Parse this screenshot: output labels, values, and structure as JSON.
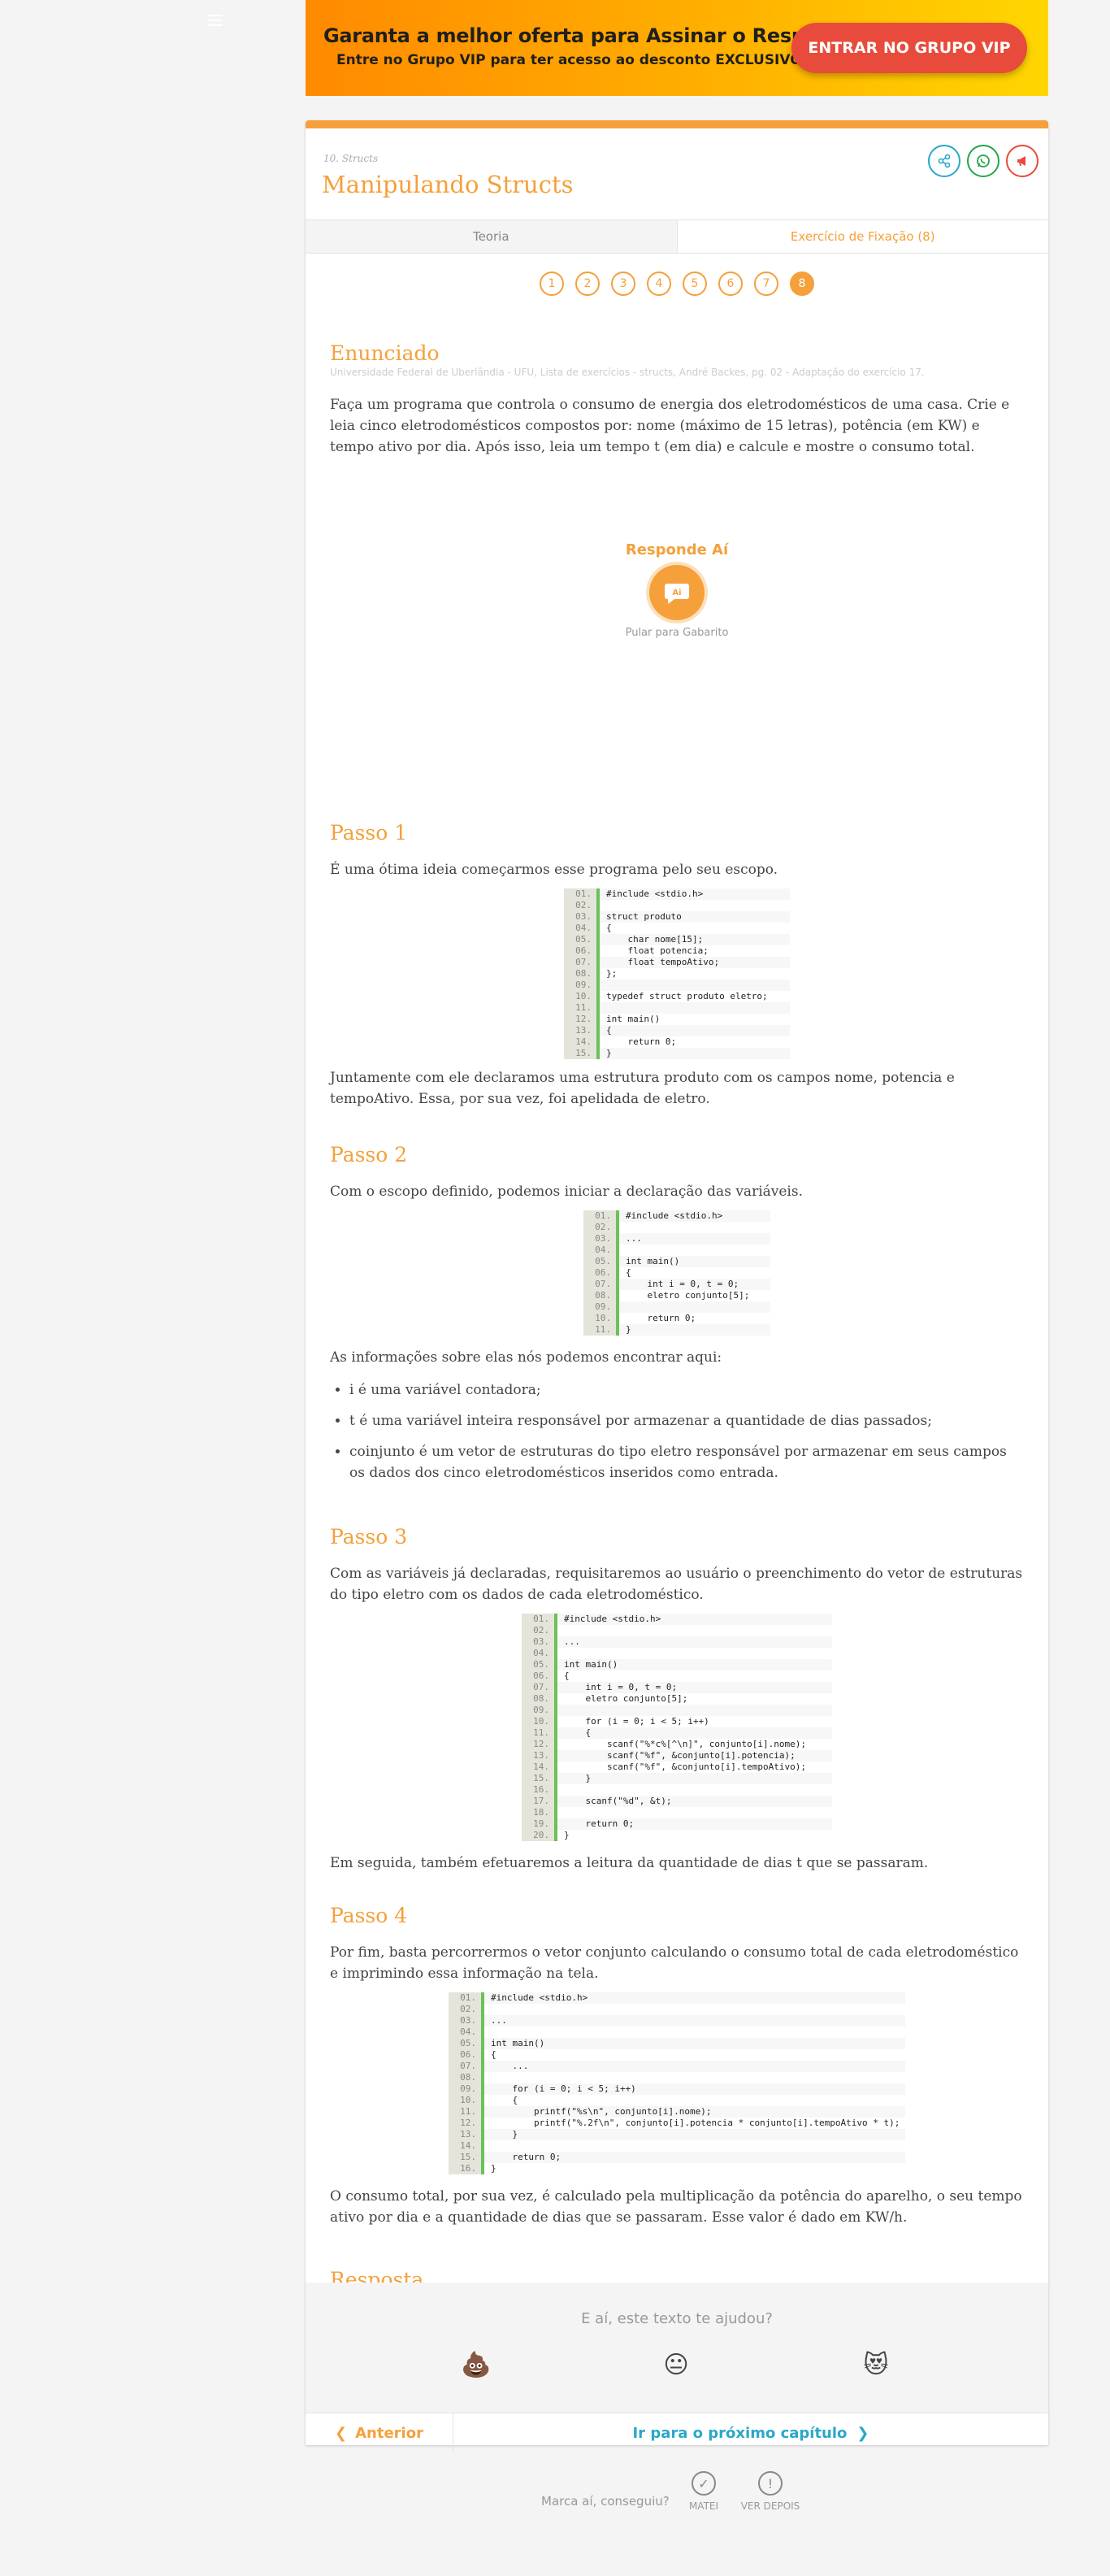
{
  "banner": {
    "headline": "Garanta a melhor oferta para Assinar o Responde Aí",
    "subline": "Entre no Grupo VIP para ter acesso ao desconto EXCLUSIVO!",
    "cta": "ENTRAR NO GRUPO VIP"
  },
  "header": {
    "breadcrumb": "10. Structs",
    "title": "Manipulando Structs",
    "share_icons": [
      "share-icon",
      "whatsapp-icon",
      "report-icon"
    ]
  },
  "tabs": [
    {
      "label": "Teoria",
      "active": false
    },
    {
      "label": "Exercício de Fixação (8)",
      "active": true
    }
  ],
  "pager": {
    "pages": [
      "1",
      "2",
      "3",
      "4",
      "5",
      "6",
      "7",
      "8"
    ],
    "current": "8"
  },
  "enunciado": {
    "heading": "Enunciado",
    "source": "Universidade Federal de Uberlândia - UFU, Lista de exercícios - structs, André Backes, pg. 02 - Adaptação do exercício 17.",
    "text": "Faça um programa que controla o consumo de energia dos eletrodomésticos de uma casa. Crie e leia cinco eletrodomésticos compostos por: nome (máximo de 15 letras), potência (em KW) e tempo ativo por dia. Após isso, leia um tempo t (em dia) e calcule e mostre o consumo total."
  },
  "responde_ai": {
    "title": "Responde Aí",
    "skip": "Pular para Gabarito"
  },
  "passos": [
    {
      "heading": "Passo 1",
      "intro": "É uma ótima ideia começarmos esse programa pelo seu escopo.",
      "code": [
        "#include <stdio.h>",
        "",
        "struct produto",
        "{",
        "    char nome[15];",
        "    float potencia;",
        "    float tempoAtivo;",
        "};",
        "",
        "typedef struct produto eletro;",
        "",
        "int main()",
        "{",
        "    return 0;",
        "}"
      ],
      "after": "Juntamente com ele declaramos uma estrutura produto com os campos nome, potencia e tempoAtivo. Essa, por sua vez, foi apelidada de eletro."
    },
    {
      "heading": "Passo 2",
      "intro": "Com o escopo definido, podemos iniciar a declaração das variáveis.",
      "code": [
        "#include <stdio.h>",
        "",
        "...",
        "",
        "int main()",
        "{",
        "    int i = 0, t = 0;",
        "    eletro conjunto[5];",
        "",
        "    return 0;",
        "}"
      ],
      "after": "As informações sobre elas nós podemos encontrar aqui:",
      "bullets": [
        "i é uma variável contadora;",
        "t é uma variável inteira responsável por armazenar a quantidade de dias passados;",
        "coinjunto é um vetor de estruturas do tipo eletro responsável por armazenar em seus campos os dados dos cinco eletrodomésticos inseridos como entrada."
      ]
    },
    {
      "heading": "Passo 3",
      "intro": "Com as variáveis já declaradas, requisitaremos ao usuário o preenchimento do vetor de estruturas do tipo eletro com os dados de cada eletrodoméstico.",
      "code": [
        "#include <stdio.h>",
        "",
        "...",
        "",
        "int main()",
        "{",
        "    int i = 0, t = 0;",
        "    eletro conjunto[5];",
        "",
        "    for (i = 0; i < 5; i++)",
        "    {",
        "        scanf(\"%*c%[^\\n]\", conjunto[i].nome);",
        "        scanf(\"%f\", &conjunto[i].potencia);",
        "        scanf(\"%f\", &conjunto[i].tempoAtivo);",
        "    }",
        "",
        "    scanf(\"%d\", &t);",
        "",
        "    return 0;",
        "}"
      ],
      "after": "Em seguida, também efetuaremos a leitura da quantidade de dias t que se passaram."
    },
    {
      "heading": "Passo 4",
      "intro": "Por fim, basta percorrermos o vetor conjunto calculando o consumo total de cada eletrodoméstico e imprimindo essa informação na tela.",
      "code": [
        "#include <stdio.h>",
        "",
        "...",
        "",
        "int main()",
        "{",
        "    ...",
        "",
        "    for (i = 0; i < 5; i++)",
        "    {",
        "        printf(\"%s\\n\", conjunto[i].nome);",
        "        printf(\"%.2f\\n\", conjunto[i].potencia * conjunto[i].tempoAtivo * t);",
        "    }",
        "",
        "    return 0;",
        "}"
      ],
      "after": "O consumo total, por sua vez, é calculado pela multiplicação da potência do aparelho, o seu tempo ativo por dia e a quantidade de dias que se passaram. Esse valor é dado em KW/h."
    }
  ],
  "resposta": {
    "heading": "Resposta"
  },
  "feedback": {
    "question": "E aí, este texto te ajudou?",
    "emojis": [
      "💩",
      "😐",
      "😻"
    ]
  },
  "nav": {
    "prev": "Anterior",
    "next": "Ir para o próximo capítulo"
  },
  "mark": {
    "label": "Marca aí, conseguiu?",
    "done": "MATEI",
    "later": "VER DEPOIS"
  },
  "colors": {
    "accent": "#f5a03b",
    "next_link": "#2aa8c8",
    "cta_bg": "#e84b3c",
    "code_border": "#6ac259"
  }
}
